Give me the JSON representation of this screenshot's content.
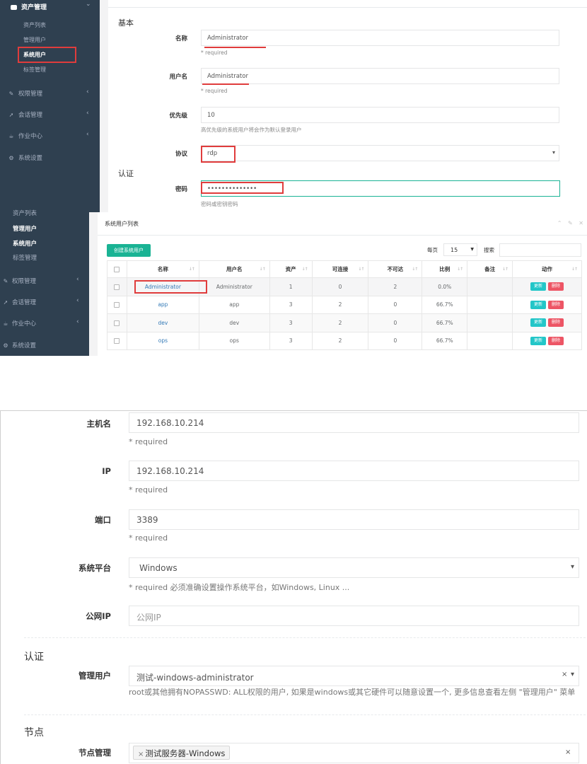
{
  "panel1": {
    "sidebar": {
      "group_title": "资产管理",
      "submenu": [
        "资产列表",
        "管理用户",
        "系统用户",
        "标签管理"
      ],
      "active": "系统用户",
      "items": [
        {
          "label": "权限管理",
          "icon": "edit-icon"
        },
        {
          "label": "会话管理",
          "icon": "rocket-icon"
        },
        {
          "label": "作业中心",
          "icon": "coffee-icon"
        },
        {
          "label": "系统设置",
          "icon": "gears-icon"
        }
      ]
    },
    "form": {
      "section_basic": "基本",
      "name_label": "名称",
      "name_value": "Administrator",
      "name_help": "* required",
      "username_label": "用户名",
      "username_value": "Administrator",
      "username_help": "* required",
      "priority_label": "优先级",
      "priority_value": "10",
      "priority_help": "高优先级的系统用户将会作为默认登录用户",
      "protocol_label": "协议",
      "protocol_value": "rdp",
      "section_auth": "认证",
      "password_label": "密码",
      "password_value": "••••••••••••••",
      "password_help": "密码或密钥密码"
    }
  },
  "panel2": {
    "sidebar": {
      "partial_top": "资产列表",
      "submenu": [
        "管理用户",
        "系统用户",
        "标签管理"
      ],
      "items": [
        {
          "label": "权限管理",
          "icon": "edit-icon"
        },
        {
          "label": "会话管理",
          "icon": "rocket-icon"
        },
        {
          "label": "作业中心",
          "icon": "coffee-icon"
        },
        {
          "label": "系统设置",
          "icon": "gears-icon"
        }
      ]
    },
    "title": "系统用户列表",
    "tool_icons": "⌃ ✎ ✕",
    "create_button": "创建系统用户",
    "per_page_label": "每页",
    "per_page_value": "15",
    "search_label": "搜索",
    "columns": [
      "名称",
      "用户名",
      "资产",
      "可连接",
      "不可达",
      "比例",
      "备注",
      "动作"
    ],
    "rows": [
      {
        "name": "Administrator",
        "username": "Administrator",
        "assets": "1",
        "connectable": "0",
        "unreachable": "2",
        "ratio": "0.0%",
        "comment": ""
      },
      {
        "name": "app",
        "username": "app",
        "assets": "3",
        "connectable": "2",
        "unreachable": "0",
        "ratio": "66.7%",
        "comment": ""
      },
      {
        "name": "dev",
        "username": "dev",
        "assets": "3",
        "connectable": "2",
        "unreachable": "0",
        "ratio": "66.7%",
        "comment": ""
      },
      {
        "name": "ops",
        "username": "ops",
        "assets": "3",
        "connectable": "2",
        "unreachable": "0",
        "ratio": "66.7%",
        "comment": ""
      }
    ],
    "update_label": "更新",
    "delete_label": "删除"
  },
  "panel3": {
    "hostname_label": "主机名",
    "hostname_value": "192.168.10.214",
    "hostname_help": "* required",
    "ip_label": "IP",
    "ip_value": "192.168.10.214",
    "ip_help": "* required",
    "port_label": "端口",
    "port_value": "3389",
    "port_help": "* required",
    "platform_label": "系统平台",
    "platform_value": "Windows",
    "platform_help": "* required 必须准确设置操作系统平台，如Windows, Linux ...",
    "public_ip_label": "公网IP",
    "public_ip_placeholder": "公网IP",
    "section_auth": "认证",
    "admin_user_label": "管理用户",
    "admin_user_value": "测试-windows-administrator",
    "admin_user_help": "root或其他拥有NOPASSWD: ALL权限的用户, 如果是windows或其它硬件可以随意设置一个, 更多信息查看左侧 \"管理用户\" 菜单",
    "section_node": "节点",
    "node_label": "节点管理",
    "node_tag": "测试服务器-Windows"
  },
  "colors": {
    "sidebar": "#2f4050",
    "primary": "#1ab394",
    "info": "#23c6c8",
    "danger": "#ed5565",
    "highlight": "#e03c3c"
  }
}
